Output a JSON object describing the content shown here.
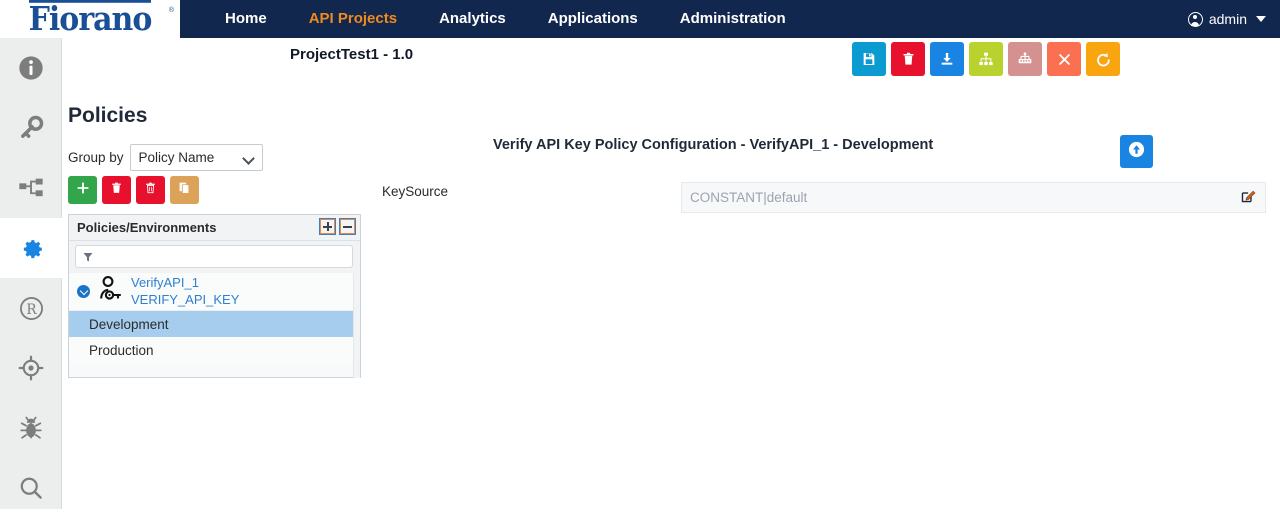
{
  "topnav": {
    "logo_text": "Fiorano",
    "logo_reg": "®",
    "items": [
      {
        "label": "Home",
        "active": false
      },
      {
        "label": "API Projects",
        "active": true
      },
      {
        "label": "Analytics",
        "active": false
      },
      {
        "label": "Applications",
        "active": false
      },
      {
        "label": "Administration",
        "active": false
      }
    ],
    "user_label": "admin",
    "brand_navy": "#12274d",
    "accent_orange": "#f0891e",
    "logo_blue": "#1a4f96"
  },
  "rail": {
    "items": [
      {
        "icon": "info-icon",
        "active": false
      },
      {
        "icon": "key-icon",
        "active": false
      },
      {
        "icon": "sitemap-icon",
        "active": false
      },
      {
        "icon": "gear-icon",
        "active": true
      },
      {
        "icon": "registered-icon",
        "active": false
      },
      {
        "icon": "target-icon",
        "active": false
      },
      {
        "icon": "bug-icon",
        "active": false
      },
      {
        "icon": "search-icon",
        "active": false
      }
    ],
    "active_color": "#1a84e2",
    "inactive_color": "#7d7d7d"
  },
  "project": {
    "title": "ProjectTest1 - 1.0",
    "toolbar": [
      {
        "name": "save-button",
        "icon": "save-icon",
        "color": "#0c9bd1"
      },
      {
        "name": "delete-button",
        "icon": "trash-icon",
        "color": "#e8112d"
      },
      {
        "name": "download-button",
        "icon": "download-icon",
        "color": "#1a84e2"
      },
      {
        "name": "sitemap-button",
        "icon": "sitemap-icon",
        "color": "#b9d22d"
      },
      {
        "name": "deploy-button",
        "icon": "network-icon",
        "color": "#d4918f"
      },
      {
        "name": "close-button",
        "icon": "close-icon",
        "color": "#fa7051"
      },
      {
        "name": "revert-button",
        "icon": "undo-icon",
        "color": "#f9a510"
      }
    ]
  },
  "policies": {
    "heading": "Policies",
    "group_by_label": "Group by",
    "group_by_value": "Policy Name",
    "actions": [
      {
        "name": "add-policy-button",
        "icon": "plus-icon",
        "color": "#33a64c"
      },
      {
        "name": "delete-policy-button",
        "icon": "trash-icon",
        "color": "#e8112d"
      },
      {
        "name": "delete-all-policies-button",
        "icon": "trash-outline-icon",
        "color": "#e8112d"
      },
      {
        "name": "copy-policy-button",
        "icon": "copy-icon",
        "color": "#dda25a"
      }
    ],
    "tree": {
      "header": "Policies/Environments",
      "expand_all": "+",
      "collapse_all": "−",
      "filter_placeholder": "",
      "filter_value": "",
      "node": {
        "name": "VerifyAPI_1",
        "subname": "VERIFY_API_KEY"
      },
      "children": [
        {
          "label": "Development",
          "selected": true
        },
        {
          "label": "Production",
          "selected": false
        }
      ],
      "selection_color": "#a6cdee"
    }
  },
  "config": {
    "title": "Verify API Key Policy Configuration - VerifyAPI_1 - Development",
    "upload_icon": "arrow-up-circle-icon",
    "upload_color": "#1a84e2",
    "fields": [
      {
        "label": "KeySource",
        "value": "",
        "placeholder": "CONSTANT|default",
        "edit_icon": "edit-pencil-icon"
      }
    ]
  }
}
